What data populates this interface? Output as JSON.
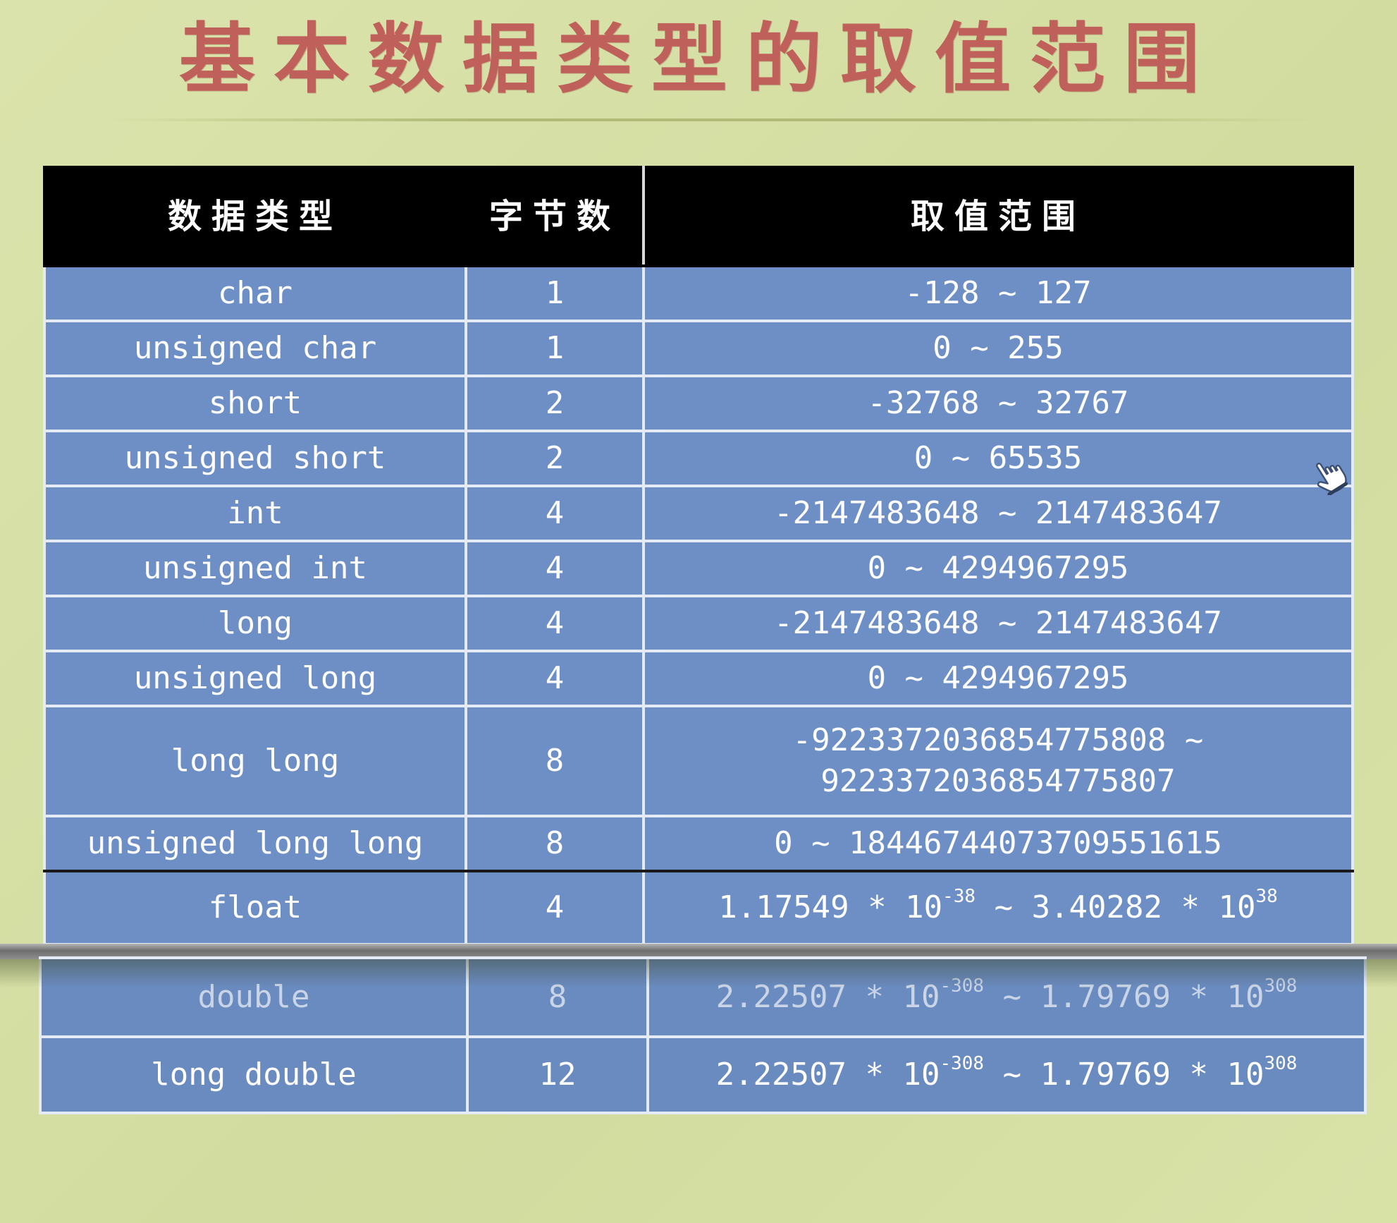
{
  "title": "基本数据类型的取值范围",
  "table": {
    "headers": [
      "数据类型",
      "字节数",
      "取值范围"
    ],
    "rows": [
      {
        "type": "char",
        "bytes": "1",
        "range": "-128 ~ 127"
      },
      {
        "type": "unsigned char",
        "bytes": "1",
        "range": "0 ~ 255"
      },
      {
        "type": "short",
        "bytes": "2",
        "range": "-32768 ~ 32767"
      },
      {
        "type": "unsigned short",
        "bytes": "2",
        "range": "0 ~ 65535"
      },
      {
        "type": "int",
        "bytes": "4",
        "range": "-2147483648 ~ 2147483647"
      },
      {
        "type": "unsigned int",
        "bytes": "4",
        "range": "0 ~ 4294967295"
      },
      {
        "type": "long",
        "bytes": "4",
        "range": "-2147483648 ~ 2147483647"
      },
      {
        "type": "unsigned long",
        "bytes": "4",
        "range": "0 ~ 4294967295"
      },
      {
        "type": "long long",
        "bytes": "8",
        "range_line1": "-9223372036854775808 ~",
        "range_line2": "9223372036854775807"
      },
      {
        "type": "unsigned long long",
        "bytes": "8",
        "range": "0 ~ 18446744073709551615"
      },
      {
        "type": "float",
        "bytes": "4",
        "range_a": "1.17549 * 10",
        "exp_a": "-38",
        "range_b": " ~ 3.40282 * 10",
        "exp_b": "38"
      }
    ],
    "bottom_rows": [
      {
        "type": "double",
        "bytes": "8",
        "range_a": "2.22507 * 10",
        "exp_a": "-308",
        "range_b": " ~ 1.79769 * 10",
        "exp_b": "308"
      },
      {
        "type": "long double",
        "bytes": "12",
        "range_a": "2.22507 * 10",
        "exp_a": "-308",
        "range_b": " ~ 1.79769 * 10",
        "exp_b": "308"
      }
    ]
  },
  "cursor_icon": "hand-pointer-icon",
  "colors": {
    "background": "#d6e0a2",
    "title": "#c0605a",
    "header": "#000000",
    "cell": "#6d8fc6",
    "cell_text": "#ffffff"
  }
}
